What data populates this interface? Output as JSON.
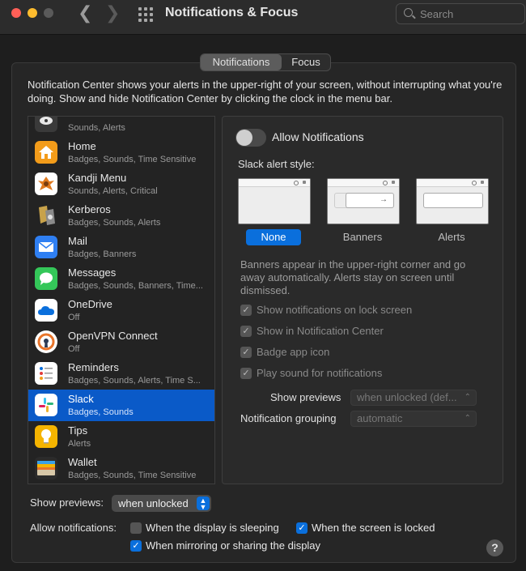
{
  "window": {
    "title": "Notifications & Focus",
    "search_placeholder": "Search"
  },
  "tabs": [
    {
      "label": "Notifications",
      "selected": true
    },
    {
      "label": "Focus",
      "selected": false
    }
  ],
  "description": "Notification Center shows your alerts in the upper-right of your screen, without interrupting what you're doing. Show and hide Notification Center by clicking the clock in the menu bar.",
  "apps": [
    {
      "name": "",
      "sub": "Sounds, Alerts",
      "icon": "partial-app-icon",
      "color": "#3a3a3a"
    },
    {
      "name": "Home",
      "sub": "Badges, Sounds, Time Sensitive",
      "icon": "home-icon",
      "color": "#f39c1a"
    },
    {
      "name": "Kandji Menu",
      "sub": "Sounds, Alerts, Critical",
      "icon": "kandji-icon",
      "color": "#ffffff"
    },
    {
      "name": "Kerberos",
      "sub": "Badges, Sounds, Alerts",
      "icon": "kerberos-icon",
      "color": "#6b6b6b"
    },
    {
      "name": "Mail",
      "sub": "Badges, Banners",
      "icon": "mail-icon",
      "color": "#2f7ff2"
    },
    {
      "name": "Messages",
      "sub": "Badges, Sounds, Banners, Time...",
      "icon": "messages-icon",
      "color": "#34c759"
    },
    {
      "name": "OneDrive",
      "sub": "Off",
      "icon": "onedrive-icon",
      "color": "#ffffff"
    },
    {
      "name": "OpenVPN Connect",
      "sub": "Off",
      "icon": "openvpn-icon",
      "color": "#ffffff"
    },
    {
      "name": "Reminders",
      "sub": "Badges, Sounds, Alerts, Time S...",
      "icon": "reminders-icon",
      "color": "#ffffff"
    },
    {
      "name": "Slack",
      "sub": "Badges, Sounds",
      "icon": "slack-icon",
      "color": "#ffffff",
      "selected": true
    },
    {
      "name": "Tips",
      "sub": "Alerts",
      "icon": "tips-icon",
      "color": "#f5b400"
    },
    {
      "name": "Wallet",
      "sub": "Badges, Sounds, Time Sensitive",
      "icon": "wallet-icon",
      "color": "#2b2b2b"
    }
  ],
  "detail": {
    "allow_label": "Allow Notifications",
    "alert_style_label": "Slack alert style:",
    "styles": {
      "none": "None",
      "banners": "Banners",
      "alerts": "Alerts"
    },
    "style_description": "Banners appear in the upper-right corner and go away automatically. Alerts stay on screen until dismissed.",
    "options": [
      "Show notifications on lock screen",
      "Show in Notification Center",
      "Badge app icon",
      "Play sound for notifications"
    ],
    "show_previews_label": "Show previews",
    "show_previews_value": "when unlocked (def...",
    "grouping_label": "Notification grouping",
    "grouping_value": "automatic"
  },
  "bottom": {
    "show_previews_label": "Show previews:",
    "show_previews_value": "when unlocked",
    "allow_label": "Allow notifications:",
    "sleeping_label": "When the display is sleeping",
    "locked_label": "When the screen is locked",
    "mirroring_label": "When mirroring or sharing the display",
    "sleeping_checked": false,
    "locked_checked": true,
    "mirroring_checked": true
  },
  "help": "?"
}
